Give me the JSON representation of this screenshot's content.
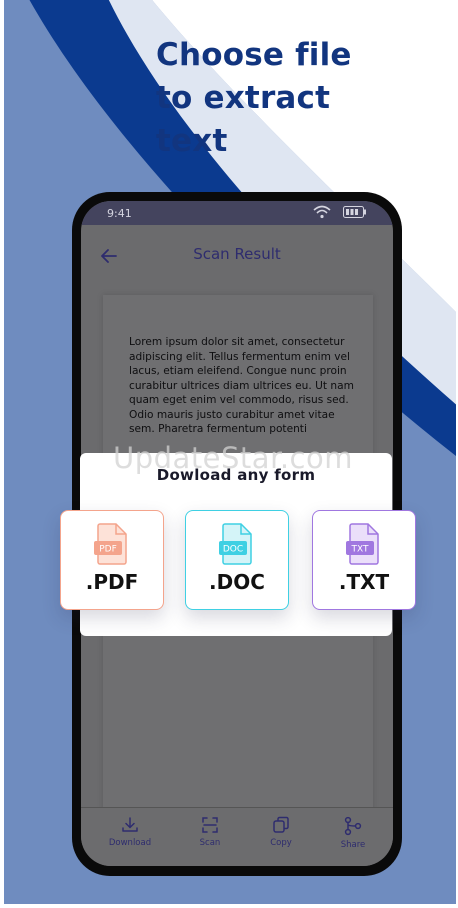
{
  "headline": {
    "line1": "Choose file",
    "line2": "to extract",
    "line3": "text"
  },
  "status_bar": {
    "time": "9:41",
    "icons": [
      "wifi-icon",
      "battery-icon"
    ]
  },
  "app_bar": {
    "title": "Scan Result",
    "back_icon": "arrow-left-icon"
  },
  "document": {
    "text": "Lorem ipsum dolor sit amet, consectetur adipiscing elit. Tellus fermentum enim vel lacus, etiam eleifend. Congue nunc proin curabitur ultrices diam ultrices eu. Ut nam quam eget enim vel commodo, risus sed. Odio mauris justo curabitur amet vitae sem. Pharetra fermentum potenti"
  },
  "watermark": "UpdateStar.com",
  "download_panel": {
    "title": "Dowload any form",
    "formats": [
      {
        "label": ".PDF",
        "icon_text": "PDF",
        "color": "#f4a48c"
      },
      {
        "label": ".DOC",
        "icon_text": "DOC",
        "color": "#3fd0e3"
      },
      {
        "label": ".TXT",
        "icon_text": "TXT",
        "color": "#a077e0"
      }
    ]
  },
  "bottom_nav": [
    {
      "label": "Download",
      "icon": "download-icon"
    },
    {
      "label": "Scan",
      "icon": "scan-icon"
    },
    {
      "label": "Copy",
      "icon": "copy-icon"
    },
    {
      "label": "Share",
      "icon": "share-icon"
    }
  ],
  "colors": {
    "background": "#6f8cbf",
    "headline": "#12357f",
    "arc_dark": "#0b3a8f",
    "arc_light": "#dfe6f2"
  }
}
